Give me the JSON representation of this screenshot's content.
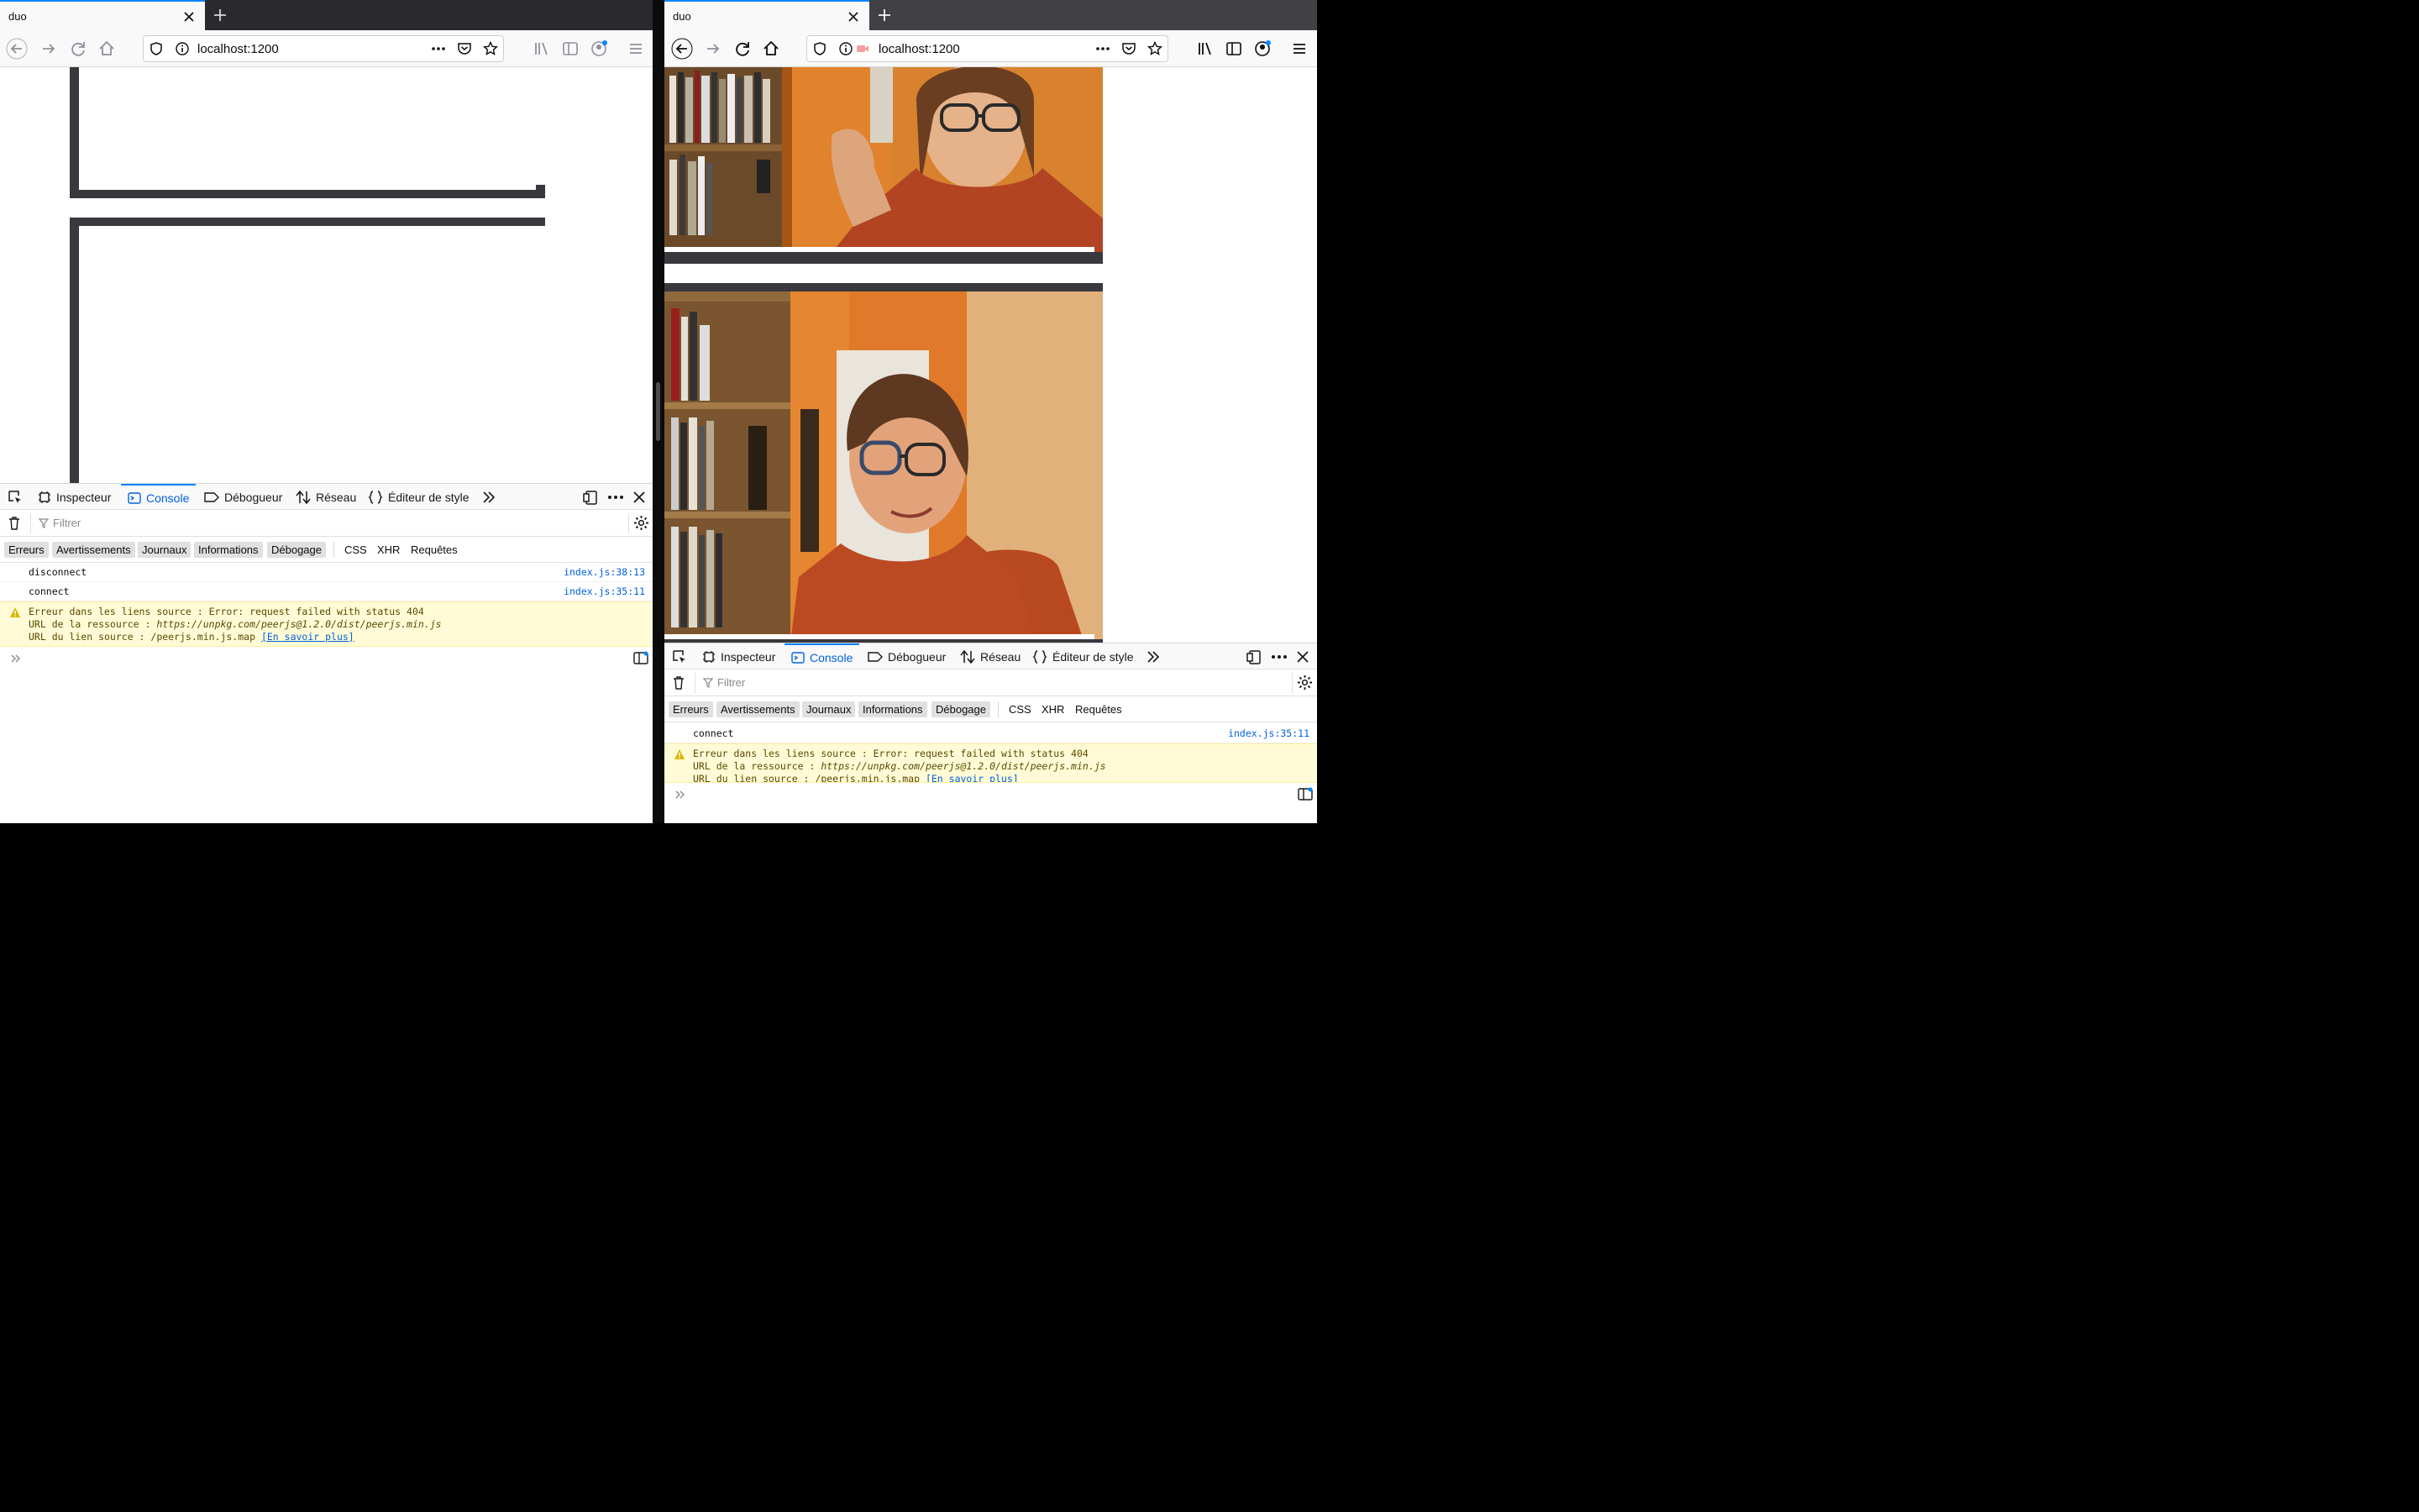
{
  "left_window": {
    "tab_title": "duo",
    "url": "localhost:1200",
    "devtools": {
      "tabs": [
        "Inspecteur",
        "Console",
        "Débogueur",
        "Réseau",
        "Éditeur de style"
      ],
      "active_tab": "Console",
      "filter_placeholder": "Filtrer",
      "levels": [
        "Erreurs",
        "Avertissements",
        "Journaux",
        "Informations",
        "Débogage"
      ],
      "types": [
        "CSS",
        "XHR",
        "Requêtes"
      ],
      "messages": [
        {
          "text": "disconnect",
          "source": "index.js:38:13"
        },
        {
          "text": "connect",
          "source": "index.js:35:11"
        }
      ],
      "warning": {
        "line1": "Erreur dans les liens source : Error: request failed with status 404",
        "line2_label": "URL de la ressource : ",
        "line2_url": "https://unpkg.com/peerjs@1.2.0/dist/peerjs.min.js",
        "line3": "URL du lien source : /peerjs.min.js.map ",
        "learn_more": "[En savoir plus]"
      }
    }
  },
  "right_window": {
    "tab_title": "duo",
    "url": "localhost:1200",
    "devtools": {
      "tabs": [
        "Inspecteur",
        "Console",
        "Débogueur",
        "Réseau",
        "Éditeur de style"
      ],
      "active_tab": "Console",
      "filter_placeholder": "Filtrer",
      "levels": [
        "Erreurs",
        "Avertissements",
        "Journaux",
        "Informations",
        "Débogage"
      ],
      "types": [
        "CSS",
        "XHR",
        "Requêtes"
      ],
      "messages": [
        {
          "text": "connect",
          "source": "index.js:35:11"
        }
      ],
      "warning": {
        "line1": "Erreur dans les liens source : Error: request failed with status 404",
        "line2_label": "URL de la ressource : ",
        "line2_url": "https://unpkg.com/peerjs@1.2.0/dist/peerjs.min.js",
        "line3": "URL du lien source : /peerjs.min.js.map ",
        "learn_more": "[En savoir plus]"
      }
    }
  },
  "colors": {
    "accent": "#0a84ff",
    "frame_bar": "#38383d",
    "warning_bg": "#fffbd6",
    "wall_orange": "#e07a2a"
  }
}
